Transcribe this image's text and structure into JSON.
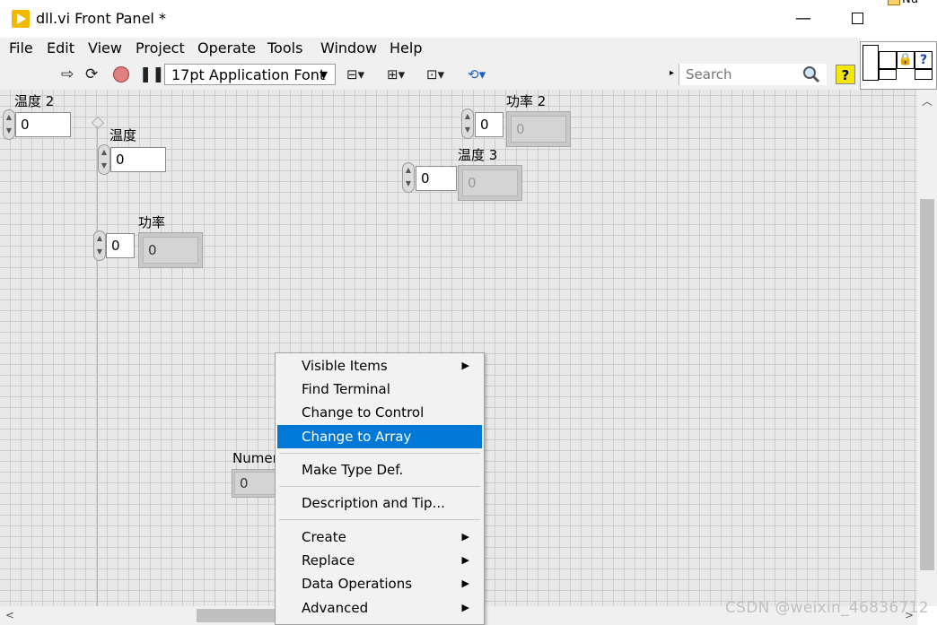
{
  "window": {
    "title": "dll.vi Front Panel *",
    "minimize": "—"
  },
  "corner": {
    "label": "Nu"
  },
  "menu": [
    "File",
    "Edit",
    "View",
    "Project",
    "Operate",
    "Tools",
    "Window",
    "Help"
  ],
  "toolbar": {
    "font": "17pt Application Font",
    "search_placeholder": "Search",
    "help": "?"
  },
  "controls": {
    "temp2": {
      "label": "温度 2",
      "value": "0"
    },
    "temp": {
      "label": "温度",
      "value": "0"
    },
    "power": {
      "label": "功率",
      "value": "0",
      "indicator": "0"
    },
    "power2": {
      "label": "功率 2",
      "value": "0",
      "indicator": "0"
    },
    "temp3": {
      "label": "温度 3",
      "value": "0",
      "indicator": "0"
    },
    "numeric": {
      "label": "Numer",
      "indicator": "0"
    }
  },
  "context_menu": {
    "items": [
      "Visible Items",
      "Find Terminal",
      "Change to Control",
      "Change to Array",
      "Make Type Def.",
      "Description and Tip...",
      "Create",
      "Replace",
      "Data Operations",
      "Advanced"
    ],
    "highlighted": "Change to Array"
  },
  "colors": {
    "highlight": "#0078d7",
    "canvas": "#e8e8e8",
    "app_icon": "#f5b800"
  },
  "watermark": "CSDN @weixin_46836712"
}
